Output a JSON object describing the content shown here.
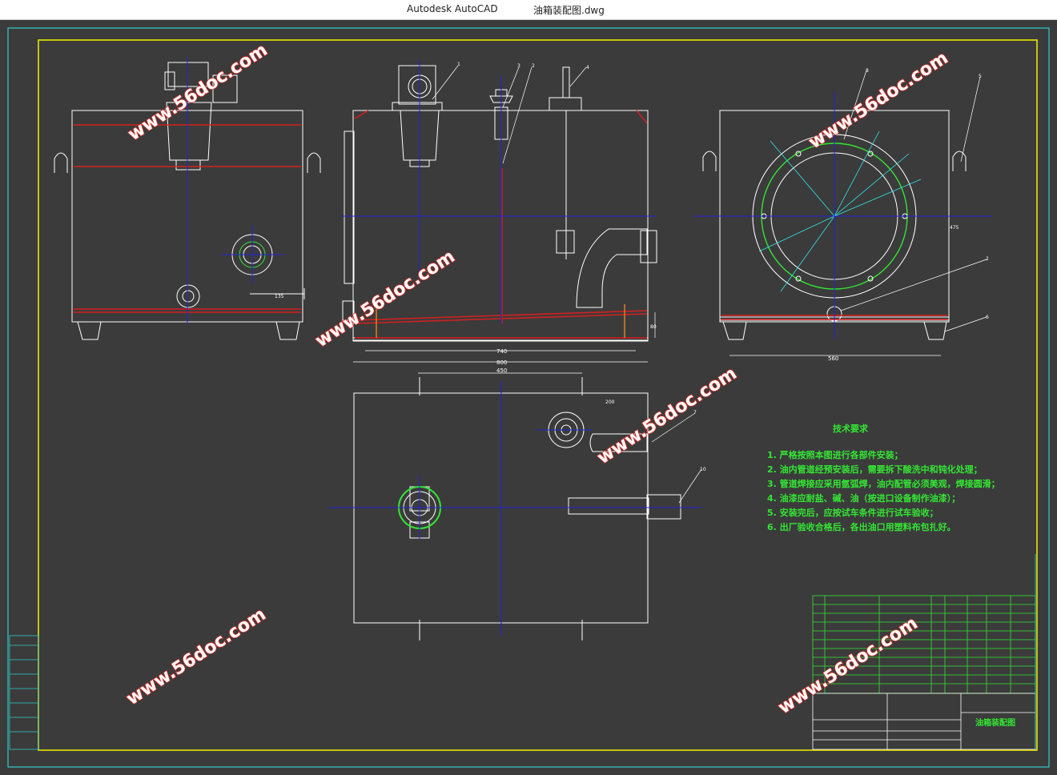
{
  "window": {
    "app_name": "Autodesk AutoCAD",
    "document_name": "油箱装配图.dwg"
  },
  "watermark": "www.56doc.com",
  "colors": {
    "background": "#3b3b3b",
    "outer_frame": "#33c9c9",
    "inner_frame": "#e6e600",
    "outline": "#ffffff",
    "center_line": "#2323d8",
    "red_line": "#d42020",
    "green_line": "#33e633",
    "cyan_line": "#33e6e6"
  },
  "drawing": {
    "dimensions": {
      "d_740": "740",
      "d_800": "800",
      "d_450": "450",
      "d_560": "560",
      "d_200": "200",
      "d_135": "135",
      "d_475": "475",
      "d_80": "80"
    },
    "balloons": [
      "1",
      "3",
      "2",
      "4",
      "8",
      "5",
      "2",
      "6",
      "7",
      "10"
    ],
    "tech_requirements": {
      "title": "技术要求",
      "items": [
        "1.  严格按照本图进行各部件安装；",
        "2.  油内管道经预安装后，需要拆下酸洗中和钝化处理；",
        "3.  管道焊接应采用氩弧焊，油内配管必须美观，焊接圆滑；",
        "4.  油漆应耐盐、碱、油（按进口设备制作油漆）；",
        "5.  安装完后，应按试车条件进行试车验收；",
        "6.  出厂验收合格后，各出油口用塑料布包扎好。"
      ]
    },
    "title_block": {
      "drawing_title": "油箱装配图"
    }
  }
}
